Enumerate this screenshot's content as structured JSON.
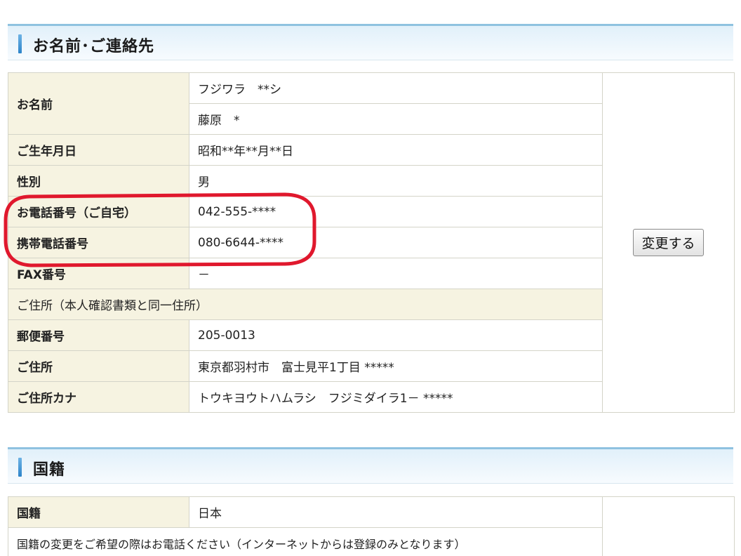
{
  "contact_section": {
    "title": "お名前･ご連絡先",
    "name_label": "お名前",
    "name_kana": "フジワラ　**シ",
    "name_kanji": "藤原　*",
    "birth_label": "ご生年月日",
    "birth_value": "昭和**年**月**日",
    "gender_label": "性別",
    "gender_value": "男",
    "home_phone_label": "お電話番号（ご自宅）",
    "home_phone_value": "042-555-****",
    "mobile_label": "携帯電話番号",
    "mobile_value": "080-6644-****",
    "fax_label": "FAX番号",
    "fax_value": "－",
    "address_heading": "ご住所（本人確認書類と同一住所）",
    "postal_label": "郵便番号",
    "postal_value": "205-0013",
    "address_label": "ご住所",
    "address_value": "東京都羽村市　富士見平1丁目 *****",
    "address_kana_label": "ご住所カナ",
    "address_kana_value": "トウキヨウトハムラシ　フジミダイラ1－ *****",
    "change_button": "変更する"
  },
  "nationality_section": {
    "title": "国籍",
    "label": "国籍",
    "value": "日本",
    "note": "国籍の変更をご希望の際はお電話ください（インターネットからは登録のみとなります）"
  },
  "annotation": {
    "color": "#e0182d"
  }
}
